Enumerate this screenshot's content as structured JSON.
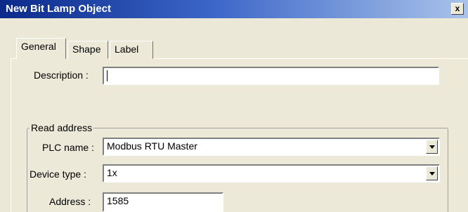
{
  "window": {
    "title": "New Bit Lamp Object",
    "close_label": "x"
  },
  "tabs": [
    {
      "label": "General",
      "active": true
    },
    {
      "label": "Shape",
      "active": false
    },
    {
      "label": "Label",
      "active": false
    }
  ],
  "description": {
    "label": "Description :",
    "value": ""
  },
  "read_address": {
    "group_label": "Read address",
    "plc_name": {
      "label": "PLC name :",
      "value": "Modbus RTU Master"
    },
    "device_type": {
      "label": "Device type :",
      "value": "1x"
    },
    "address": {
      "label": "Address :",
      "value": "1585"
    }
  }
}
